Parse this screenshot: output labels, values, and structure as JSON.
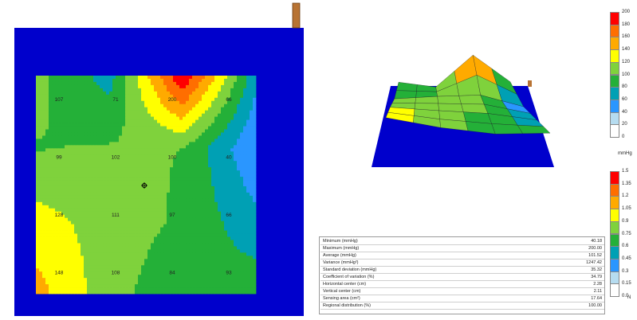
{
  "colors": {
    "frame": "#0000cc",
    "handle": "#b87333",
    "band_colors": [
      "#ffffff",
      "#b6dcf0",
      "#2a96ff",
      "#00a0b4",
      "#24b038",
      "#7fd23c",
      "#ffff00",
      "#ffaa00",
      "#ff6e00",
      "#ff0000"
    ]
  },
  "pressure_map": {
    "grid_values": [
      [
        107,
        71,
        200,
        66
      ],
      [
        99,
        102,
        100,
        40
      ],
      [
        128,
        111,
        97,
        66
      ],
      [
        148,
        108,
        84,
        93
      ]
    ],
    "labels": [
      {
        "text": "107",
        "row": 0,
        "col": 0
      },
      {
        "text": "71",
        "row": 0,
        "col": 1
      },
      {
        "text": "200",
        "row": 0,
        "col": 2
      },
      {
        "text": "66",
        "row": 0,
        "col": 3
      },
      {
        "text": "99",
        "row": 1,
        "col": 0
      },
      {
        "text": "102",
        "row": 1,
        "col": 1
      },
      {
        "text": "100",
        "row": 1,
        "col": 2
      },
      {
        "text": "40",
        "row": 1,
        "col": 3
      },
      {
        "text": "128",
        "row": 2,
        "col": 0
      },
      {
        "text": "111",
        "row": 2,
        "col": 1
      },
      {
        "text": "97",
        "row": 2,
        "col": 2
      },
      {
        "text": "66",
        "row": 2,
        "col": 3
      },
      {
        "text": "148",
        "row": 3,
        "col": 0
      },
      {
        "text": "108",
        "row": 3,
        "col": 1
      },
      {
        "text": "84",
        "row": 3,
        "col": 2
      },
      {
        "text": "93",
        "row": 3,
        "col": 3
      }
    ]
  },
  "pressure_scale": {
    "unit": "mmHg",
    "ticks": [
      "200",
      "180",
      "160",
      "140",
      "120",
      "100",
      "80",
      "60",
      "40",
      "20",
      "0"
    ]
  },
  "force_scale": {
    "unit": "N",
    "ticks": [
      "1.5",
      "1.35",
      "1.2",
      "1.05",
      "0.9",
      "0.75",
      "0.6",
      "0.45",
      "0.3",
      "0.15",
      "0.0"
    ]
  },
  "stats": [
    {
      "label": "Minimum (mmHg)",
      "value": "40.18"
    },
    {
      "label": "Maximum (mmHg)",
      "value": "200.00"
    },
    {
      "label": "Average (mmHg)",
      "value": "101.52"
    },
    {
      "label": "Variance (mmHg²)",
      "value": "1247.42"
    },
    {
      "label": "Standard deviation (mmHg)",
      "value": "35.32"
    },
    {
      "label": "Coefficient of variation (%)",
      "value": "34.79"
    },
    {
      "label": "Horizontal center (cm)",
      "value": "2.28"
    },
    {
      "label": "Vertical center (cm)",
      "value": "2.11"
    },
    {
      "label": "Sensing area (cm²)",
      "value": "17.64"
    },
    {
      "label": "Regional distribution (%)",
      "value": "100.00"
    }
  ]
}
